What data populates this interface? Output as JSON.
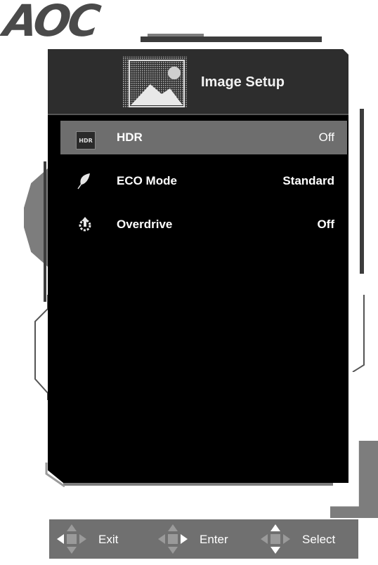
{
  "brand": {
    "logo_text": "AOC"
  },
  "osd": {
    "title": "Image Setup",
    "rows": [
      {
        "label": "HDR",
        "value": "Off",
        "icon": "hdr-icon",
        "icon_text": "HDR",
        "selected": true
      },
      {
        "label": "ECO Mode",
        "value": "Standard",
        "icon": "leaf-icon",
        "selected": false
      },
      {
        "label": "Overdrive",
        "value": "Off",
        "icon": "overdrive-icon",
        "selected": false
      }
    ]
  },
  "nav": {
    "exit_label": "Exit",
    "enter_label": "Enter",
    "select_label": "Select"
  },
  "colors": {
    "panel_bg": "#000000",
    "header_bg": "#2d2d2d",
    "selected_row_bg": "#6e6e6e",
    "navbar_bg": "#707070",
    "active_arrow": "#ffffff",
    "inactive_arrow": "#9a9a9a"
  }
}
